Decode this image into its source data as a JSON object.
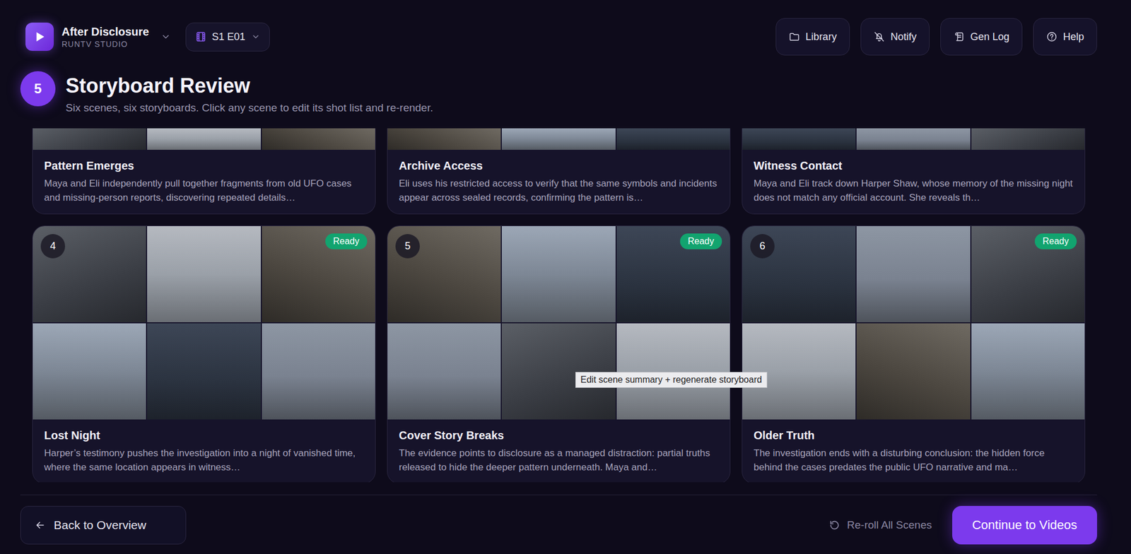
{
  "app": {
    "title": "After Disclosure",
    "subtitle": "RUNTV STUDIO"
  },
  "episode": {
    "label": "S1 E01"
  },
  "toolbar": [
    {
      "label": "Library"
    },
    {
      "label": "Notify"
    },
    {
      "label": "Gen Log"
    },
    {
      "label": "Help"
    }
  ],
  "step": {
    "number": "5",
    "title": "Storyboard Review",
    "subtitle": "Six scenes, six storyboards. Click any scene to edit its shot list and re-render."
  },
  "scenes": [
    {
      "kind": "clipped",
      "title": "Pattern Emerges",
      "summary": "Maya and Eli independently pull together fragments from old UFO cases and missing-person reports, discovering repeated details…",
      "hovered": false
    },
    {
      "kind": "clipped",
      "title": "Archive Access",
      "summary": "Eli uses his restricted access to verify that the same symbols and incidents appear across sealed records, confirming the pattern is…",
      "hovered": false
    },
    {
      "kind": "clipped",
      "title": "Witness Contact",
      "summary": "Maya and Eli track down Harper Shaw, whose memory of the missing night does not match any official account. She reveals th…",
      "hovered": false
    },
    {
      "kind": "full",
      "number": "4",
      "status": "Ready",
      "title": "Lost Night",
      "summary": "Harper’s testimony pushes the investigation into a night of vanished time, where the same location appears in witness…",
      "hovered": false
    },
    {
      "kind": "full",
      "number": "5",
      "status": "Ready",
      "title": "Cover Story Breaks",
      "summary": "The evidence points to disclosure as a managed distraction: partial truths released to hide the deeper pattern underneath. Maya and…",
      "hovered": true
    },
    {
      "kind": "full",
      "number": "6",
      "status": "Ready",
      "title": "Older Truth",
      "summary": "The investigation ends with a disturbing conclusion: the hidden force behind the cases predates the public UFO narrative and ma…",
      "hovered": false
    }
  ],
  "tooltip": {
    "text": "Edit scene summary + regenerate storyboard"
  },
  "footer": {
    "back": "Back to Overview",
    "reroll": "Re-roll All Scenes",
    "continue": "Continue to Videos"
  }
}
